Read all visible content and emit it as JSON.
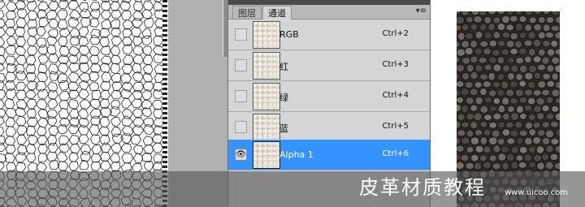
{
  "panel": {
    "tabs": [
      {
        "label": "图层",
        "active": false
      },
      {
        "label": "通道",
        "active": true
      }
    ],
    "menu_icon": "panel-menu-icon",
    "channels": [
      {
        "name": "RGB",
        "shortcut": "Ctrl+2",
        "visible": false,
        "selected": false
      },
      {
        "name": "红",
        "shortcut": "Ctrl+3",
        "visible": false,
        "selected": false
      },
      {
        "name": "绿",
        "shortcut": "Ctrl+4",
        "visible": false,
        "selected": false
      },
      {
        "name": "蓝",
        "shortcut": "Ctrl+5",
        "visible": false,
        "selected": false
      },
      {
        "name": "Alpha 1",
        "shortcut": "Ctrl+6",
        "visible": true,
        "selected": true
      }
    ]
  },
  "banner": {
    "title": "皮革材质教程",
    "url": "www.uicoo.com"
  },
  "colors": {
    "selection": "#3593ff",
    "panel_bg": "#d5d5d5",
    "workspace": "#b0b0b0"
  }
}
